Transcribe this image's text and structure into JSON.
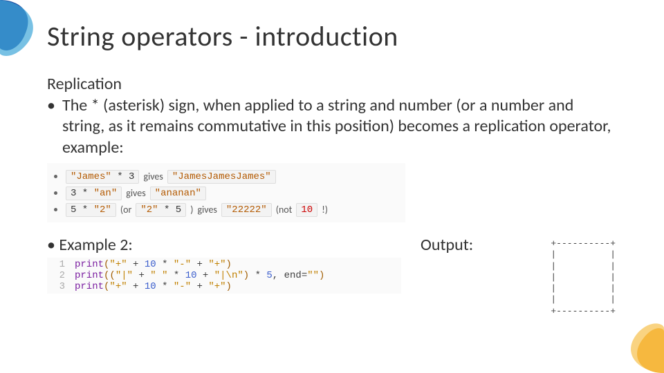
{
  "title": "String operators - introduction",
  "section": "Replication",
  "bullet_main": "The * (asterisk) sign, when applied to a string and number (or a number and string, as it remains commutative in this position) becomes a replication operator, example:",
  "ex": {
    "r1": {
      "a": "\"James\"",
      "b": "3",
      "gives": "gives",
      "res": "\"JamesJamesJames\""
    },
    "r2": {
      "a": "3",
      "b": "\"an\"",
      "gives": "gives",
      "res": "\"ananan\""
    },
    "r3": {
      "a": "5",
      "b": "\"2\"",
      "or": "(or",
      "c": "\"2\"",
      "d": "5",
      "close": ")",
      "gives": "gives",
      "res": "\"22222\"",
      "not": "(not",
      "wrong": "10",
      "bang": "!)"
    }
  },
  "ex2_label": "Example 2:",
  "out_label": "Output:",
  "code": {
    "l1": {
      "ln": "1",
      "fn": "print",
      "p1": "\"+\"",
      "p2": "10",
      "p3": "\"-\"",
      "p4": "\"+\""
    },
    "l2": {
      "ln": "2",
      "fn": "print",
      "p1": "\"|\"",
      "p2": "\" \"",
      "p3": "10",
      "p4": "\"|\\n\"",
      "p5": "5",
      "end": "end",
      "endv": "\"\""
    },
    "l3": {
      "ln": "3",
      "fn": "print",
      "p1": "\"+\"",
      "p2": "10",
      "p3": "\"-\"",
      "p4": "\"+\""
    }
  },
  "output_text": "+----------+\n|          |\n|          |\n|          |\n|          |\n|          |\n+----------+"
}
